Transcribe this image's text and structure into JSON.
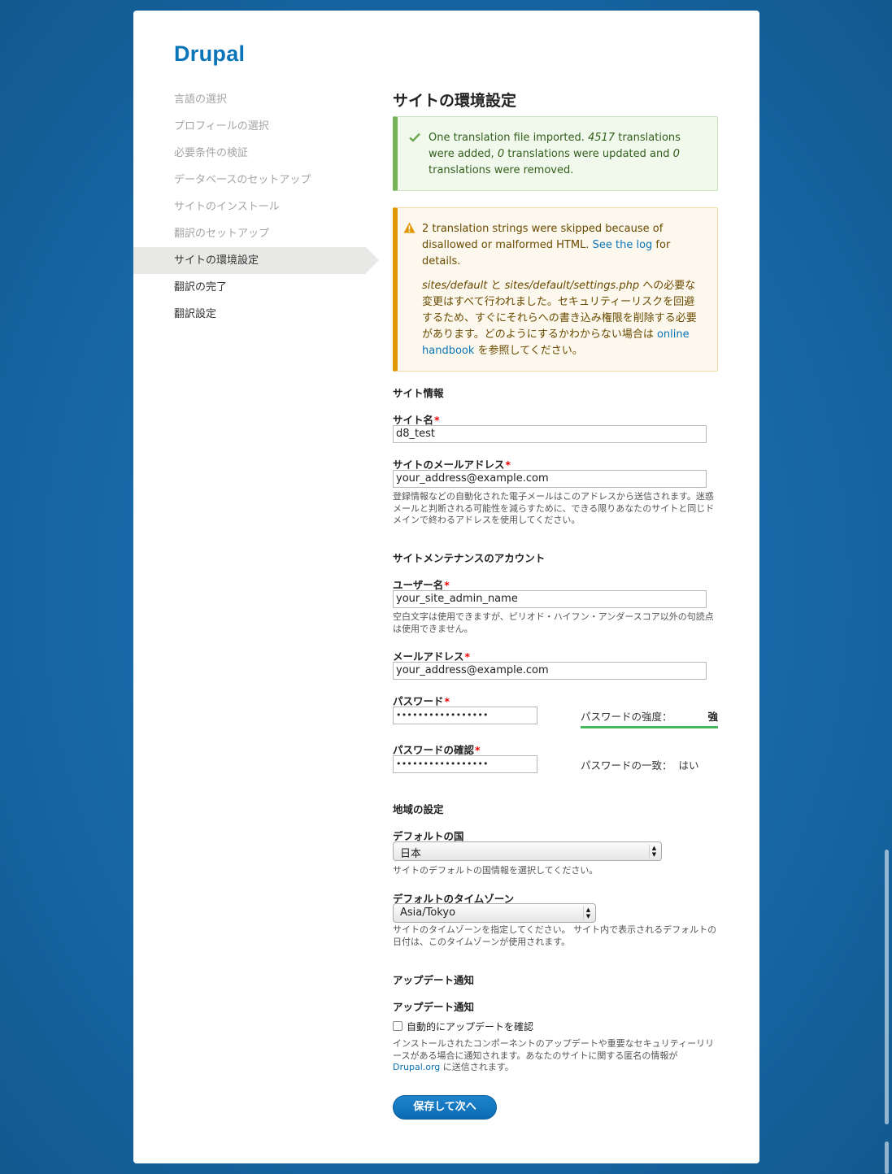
{
  "brand": "Drupal",
  "steps": [
    {
      "label": "言語の選択",
      "state": "done"
    },
    {
      "label": "プロフィールの選択",
      "state": "done"
    },
    {
      "label": "必要条件の検証",
      "state": "done"
    },
    {
      "label": "データベースのセットアップ",
      "state": "done"
    },
    {
      "label": "サイトのインストール",
      "state": "done"
    },
    {
      "label": "翻訳のセットアップ",
      "state": "done"
    },
    {
      "label": "サイトの環境設定",
      "state": "active"
    },
    {
      "label": "翻訳の完了",
      "state": "todo"
    },
    {
      "label": "翻訳設定",
      "state": "todo"
    }
  ],
  "page_title": "サイトの環境設定",
  "status_message": {
    "t1": "One translation file imported. ",
    "n1": "4517",
    "t2": " translations were added, ",
    "n2": "0",
    "t3": " translations were updated and ",
    "n3": "0",
    "t4": " translations were removed."
  },
  "warning_message": {
    "p1_text": "2 translation strings were skipped because of disallowed or malformed HTML. ",
    "p1_link": "See the log",
    "p1_tail": " for details.",
    "path1": "sites/default",
    "and": " と ",
    "path2": "sites/default/settings.php",
    "p2_text": " への必要な変更はすべて行われました。セキュリティーリスクを回避するため、すぐにそれらへの書き込み権限を削除する必要があります。どのようにするかわからない場合は ",
    "p2_link": "online handbook",
    "p2_tail": " を参照してください。"
  },
  "site_info": {
    "section_title": "サイト情報",
    "site_name_label": "サイト名",
    "site_name_value": "d8_test",
    "site_mail_label": "サイトのメールアドレス",
    "site_mail_value": "your_address@example.com",
    "site_mail_desc": "登録情報などの自動化された電子メールはこのアドレスから送信されます。迷惑メールと判断される可能性を減らすために、できる限りあなたのサイトと同じドメインで終わるアドレスを使用してください。"
  },
  "admin_account": {
    "section_title": "サイトメンテナンスのアカウント",
    "username_label": "ユーザー名",
    "username_value": "your_site_admin_name",
    "username_desc": "空白文字は使用できますが、ピリオド・ハイフン・アンダースコア以外の句読点は使用できません。",
    "mail_label": "メールアドレス",
    "mail_value": "your_address@example.com",
    "pass_label": "パスワード",
    "pass_value": "•••••••••••••••••",
    "strength_label": "パスワードの強度：",
    "strength_value": "強",
    "strength_level": 1.0,
    "strength_color": "#43b85b",
    "confirm_label": "パスワードの確認",
    "confirm_value": "•••••••••••••••••",
    "match_label": "パスワードの一致：",
    "match_value": "はい"
  },
  "regional": {
    "section_title": "地域の設定",
    "country_label": "デフォルトの国",
    "country_value": "日本",
    "country_desc": "サイトのデフォルトの国情報を選択してください。",
    "timezone_label": "デフォルトのタイムゾーン",
    "timezone_value": "Asia/Tokyo",
    "timezone_desc": "サイトのタイムゾーンを指定してください。 サイト内で表示されるデフォルトの日付は、このタイムゾーンが使用されます。"
  },
  "update": {
    "section_title": "アップデート通知",
    "sub_title": "アップデート通知",
    "checkbox_label": "自動的にアップデートを確認",
    "checkbox_checked": false,
    "desc": "インストールされたコンポーネントのアップデートや重要なセキュリティーリリースがある場合に通知されます。あなたのサイトに関する匿名の情報が ",
    "desc_link": "Drupal.org",
    "desc_tail": " に送信されます。"
  },
  "submit_label": "保存して次へ",
  "colors": {
    "accent": "#0a74b8",
    "background": "#1b6aa8",
    "status": "#77b259",
    "warning": "#e09600"
  }
}
